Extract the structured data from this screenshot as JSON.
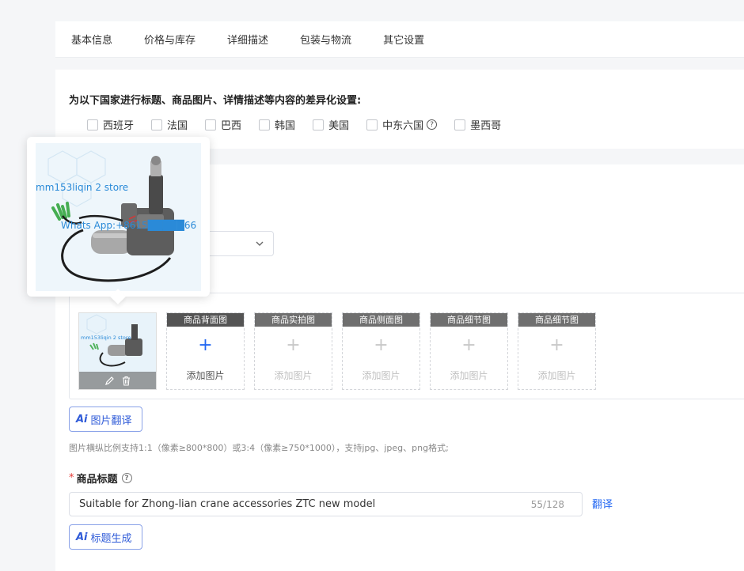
{
  "tabs": [
    "基本信息",
    "价格与库存",
    "详细描述",
    "包装与物流",
    "其它设置"
  ],
  "country_section": {
    "title": "为以下国家进行标题、商品图片、详情描述等内容的差异化设置:",
    "countries": [
      "西班牙",
      "法国",
      "巴西",
      "韩国",
      "美国",
      "中东六国",
      "墨西哥"
    ]
  },
  "images": {
    "watermark_store": "mm153liqin 2 store",
    "watermark_whatsapp": "Whats App:+8615█████66",
    "slots": [
      {
        "label": "商品背面图",
        "add": "添加图片",
        "active": true
      },
      {
        "label": "商品实拍图",
        "add": "添加图片",
        "active": false
      },
      {
        "label": "商品侧面图",
        "add": "添加图片",
        "active": false
      },
      {
        "label": "商品细节图",
        "add": "添加图片",
        "active": false
      },
      {
        "label": "商品细节图",
        "add": "添加图片",
        "active": false
      }
    ],
    "translate_button": "图片翻译",
    "hint": "图片横纵比例支持1:1（像素≥800*800）或3:4（像素≥750*1000），支持jpg、jpeg、png格式;"
  },
  "product_title": {
    "label": "商品标题",
    "required_mark": "*",
    "value": "Suitable for Zhong-lian crane accessories ZTC new model",
    "count": "55/128",
    "translate_link": "翻译",
    "generate_button": "标题生成"
  },
  "ai_mark": "Ai",
  "colors": {
    "accent": "#2468f2",
    "required": "#e53935"
  }
}
